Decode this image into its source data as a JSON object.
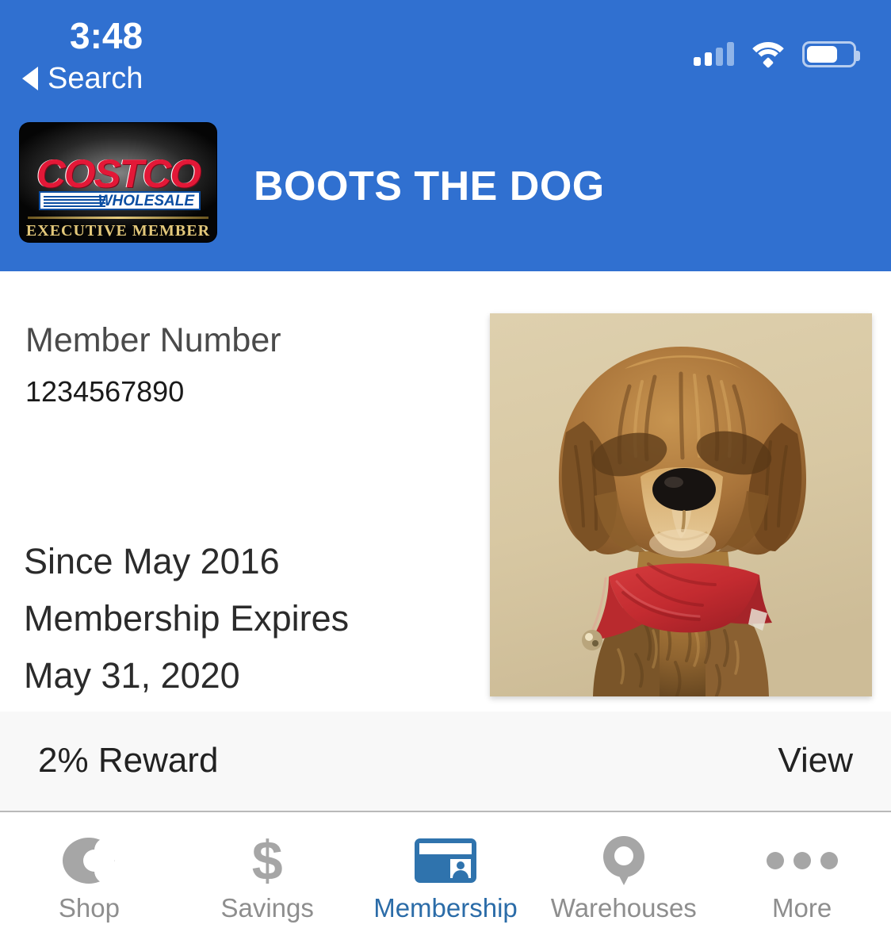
{
  "status_bar": {
    "time": "3:48",
    "signal_icon": "signal-bars-icon",
    "wifi_icon": "wifi-icon",
    "battery_icon": "battery-icon",
    "battery_level_percent": 62
  },
  "back_link": {
    "label": "Search",
    "icon": "back-caret-icon"
  },
  "header": {
    "title": "BOOTS THE DOG",
    "background_color": "#3070d0",
    "card_logo": {
      "brand": "COSTCO",
      "sub_brand": "WHOLESALE",
      "tier": "EXECUTIVE MEMBER",
      "brand_color": "#e31837",
      "sub_brand_color": "#0b4ea2",
      "tier_color": "#e3c87a",
      "card_color": "#050505"
    }
  },
  "membership": {
    "member_number_label": "Member Number",
    "member_number_value": "1234567890",
    "since_line": "Since May 2016",
    "expires_label": "Membership Expires",
    "expires_date": "May 31, 2020",
    "photo_alt": "boots-the-dog-photo"
  },
  "reward_row": {
    "label": "2% Reward",
    "action": "View",
    "background_color": "#f8f8f8"
  },
  "tabbar": {
    "active_color": "#2b6ca8",
    "inactive_color": "#8e8e8e",
    "items": [
      {
        "label": "Shop",
        "icon": "costco-c-icon",
        "active": false
      },
      {
        "label": "Savings",
        "icon": "dollar-sign-icon",
        "active": false
      },
      {
        "label": "Membership",
        "icon": "membership-card-icon",
        "active": true
      },
      {
        "label": "Warehouses",
        "icon": "map-pin-icon",
        "active": false
      },
      {
        "label": "More",
        "icon": "ellipsis-icon",
        "active": false
      }
    ]
  }
}
